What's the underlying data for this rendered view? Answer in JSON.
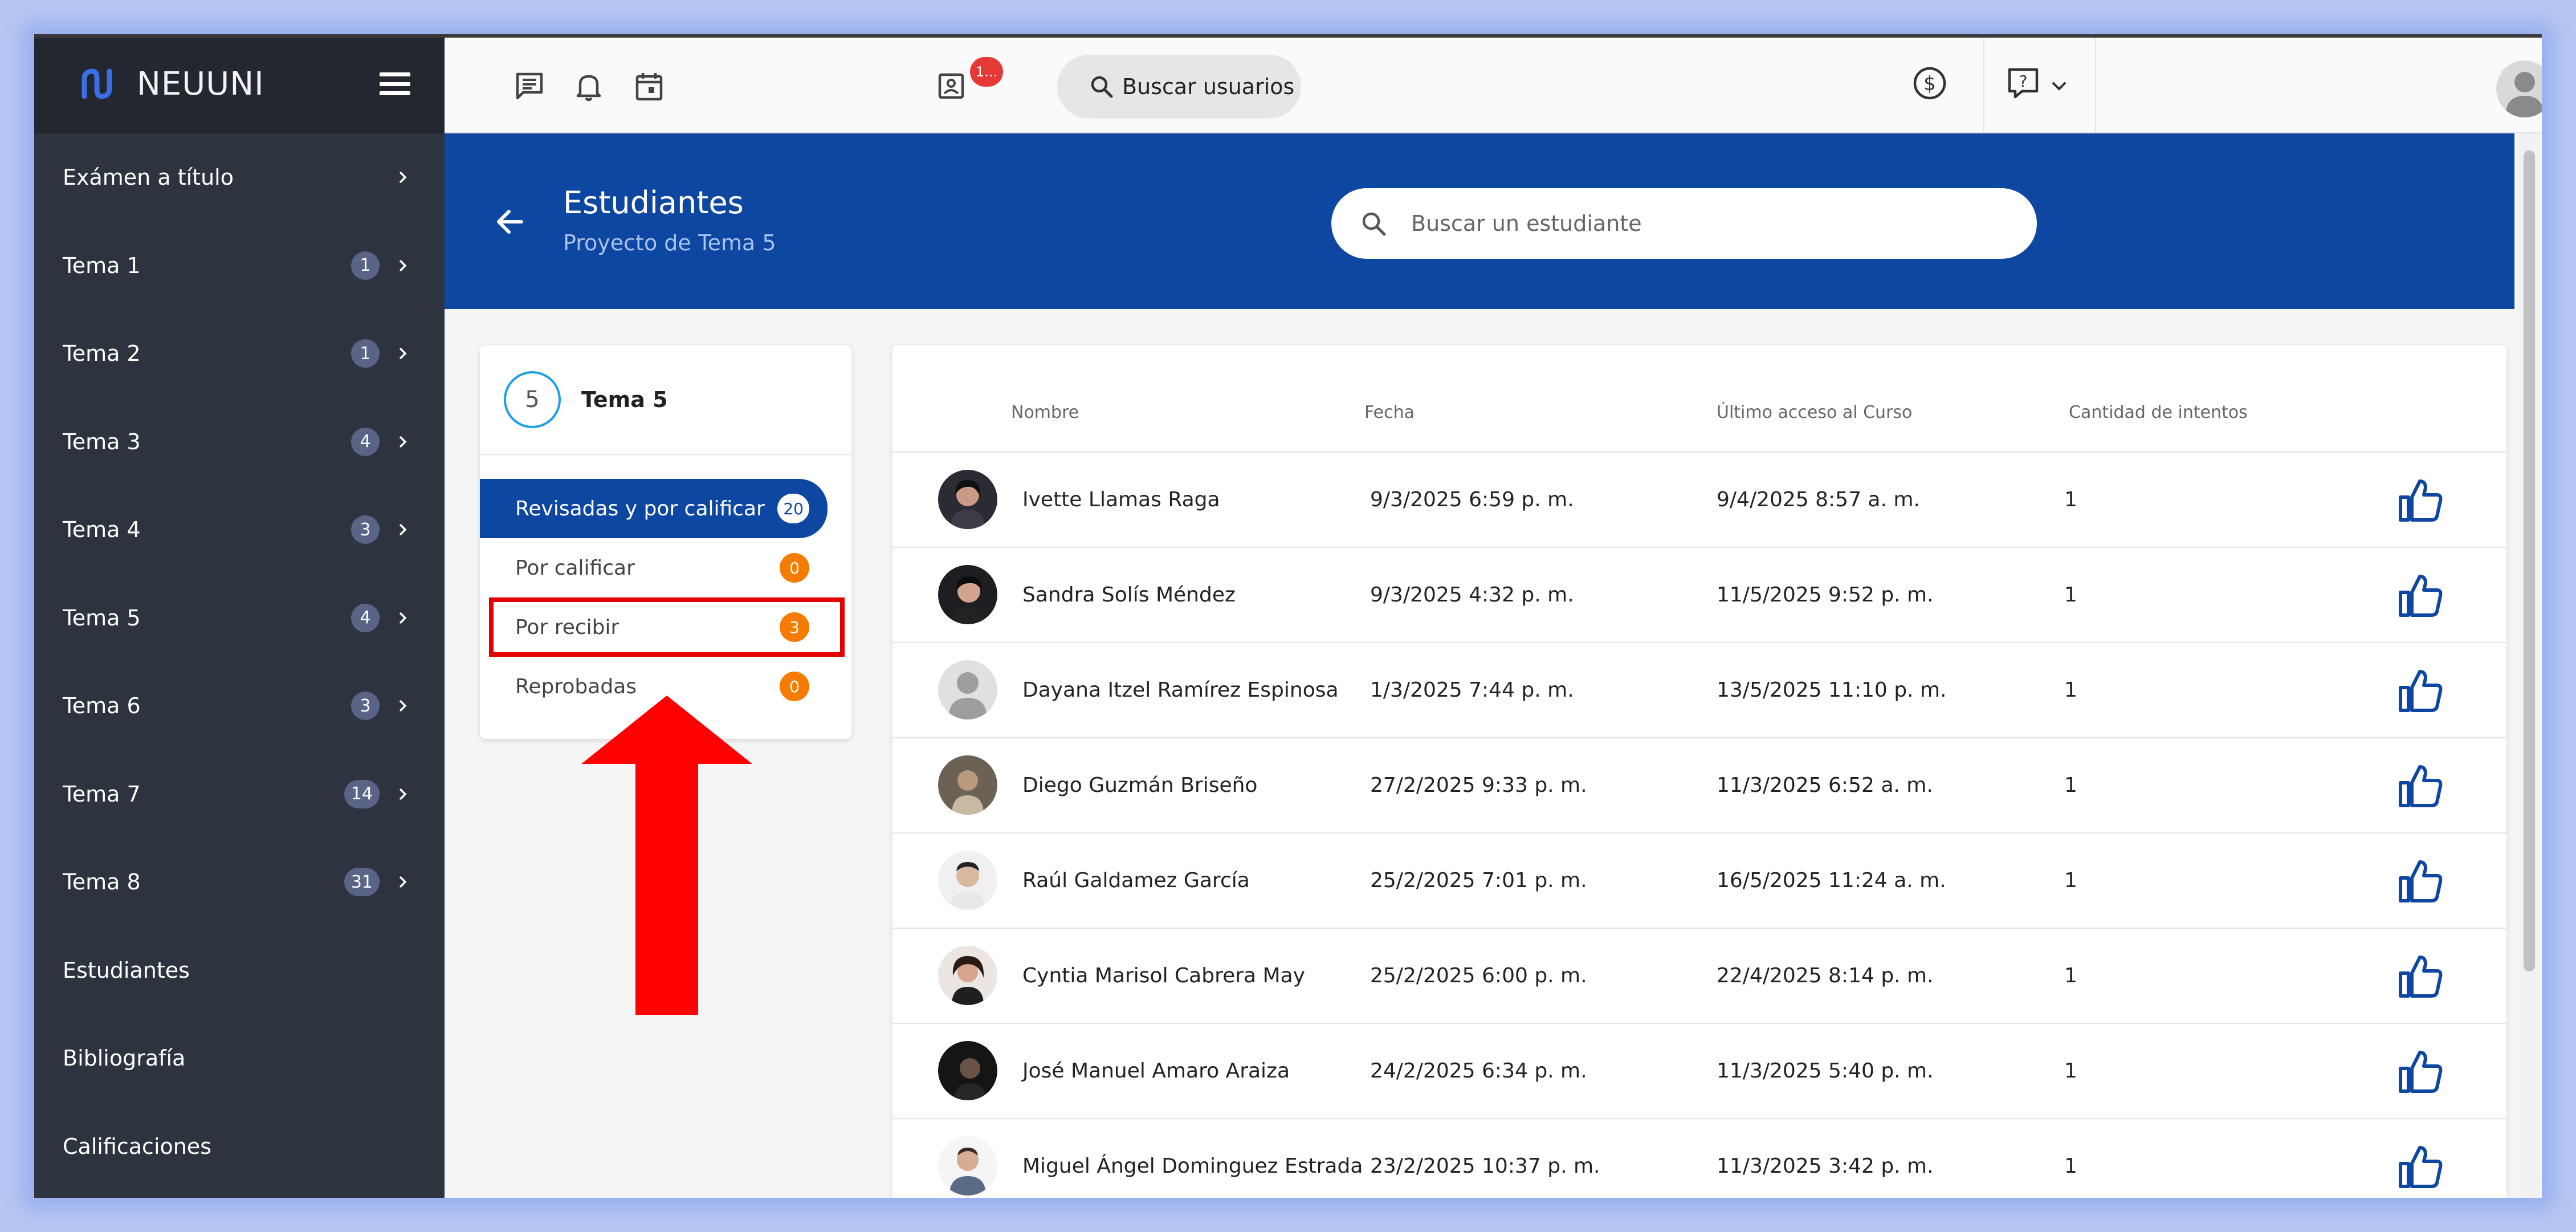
{
  "brand": {
    "name": "NEUUNI"
  },
  "sidebar": {
    "items": [
      {
        "label": "Exámen a título",
        "badge": ""
      },
      {
        "label": "Tema 1",
        "badge": "1"
      },
      {
        "label": "Tema 2",
        "badge": "1"
      },
      {
        "label": "Tema 3",
        "badge": "4"
      },
      {
        "label": "Tema 4",
        "badge": "3"
      },
      {
        "label": "Tema 5",
        "badge": "4"
      },
      {
        "label": "Tema 6",
        "badge": "3"
      },
      {
        "label": "Tema 7",
        "badge": "14"
      },
      {
        "label": "Tema 8",
        "badge": "31"
      },
      {
        "label": "Estudiantes"
      },
      {
        "label": "Bibliografía"
      },
      {
        "label": "Calificaciones"
      }
    ]
  },
  "topbar": {
    "notification_count": "1...",
    "search_users_label": "Buscar usuarios"
  },
  "header": {
    "title": "Estudiantes",
    "subtitle": "Proyecto de Tema 5",
    "search_placeholder": "Buscar un estudiante"
  },
  "filter_card": {
    "tema_number": "5",
    "tema_title": "Tema 5",
    "filters": [
      {
        "label": "Revisadas y por calificar",
        "count": "20"
      },
      {
        "label": "Por calificar",
        "count": "0"
      },
      {
        "label": "Por recibir",
        "count": "3"
      },
      {
        "label": "Reprobadas",
        "count": "0"
      }
    ]
  },
  "table": {
    "headers": {
      "nombre": "Nombre",
      "fecha": "Fecha",
      "ultimo": "Último acceso al Curso",
      "intentos": "Cantidad de intentos"
    },
    "rows": [
      {
        "nombre": "Ivette Llamas Raga",
        "fecha": "9/3/2025 6:59 p. m.",
        "ultimo": "9/4/2025 8:57 a. m.",
        "intentos": "1"
      },
      {
        "nombre": "Sandra Solís Méndez",
        "fecha": "9/3/2025 4:32 p. m.",
        "ultimo": "11/5/2025 9:52 p. m.",
        "intentos": "1"
      },
      {
        "nombre": "Dayana Itzel Ramírez Espinosa",
        "fecha": "1/3/2025 7:44 p. m.",
        "ultimo": "13/5/2025 11:10 p. m.",
        "intentos": "1"
      },
      {
        "nombre": "Diego Guzmán Briseño",
        "fecha": "27/2/2025 9:33 p. m.",
        "ultimo": "11/3/2025 6:52 a. m.",
        "intentos": "1"
      },
      {
        "nombre": "Raúl Galdamez García",
        "fecha": "25/2/2025 7:01 p. m.",
        "ultimo": "16/5/2025 11:24 a. m.",
        "intentos": "1"
      },
      {
        "nombre": "Cyntia Marisol Cabrera May",
        "fecha": "25/2/2025 6:00 p. m.",
        "ultimo": "22/4/2025 8:14 p. m.",
        "intentos": "1"
      },
      {
        "nombre": "José Manuel Amaro Araiza",
        "fecha": "24/2/2025 6:34 p. m.",
        "ultimo": "11/3/2025 5:40 p. m.",
        "intentos": "1"
      },
      {
        "nombre": "Miguel Ángel Dominguez Estrada",
        "fecha": "23/2/2025 10:37 p. m.",
        "ultimo": "11/3/2025 3:42 p. m.",
        "intentos": "1"
      }
    ]
  },
  "colors": {
    "primary": "#0d47a1",
    "sidebar": "#2e3340",
    "badge_orange": "#f57c00",
    "annotation_red": "#e30000"
  }
}
